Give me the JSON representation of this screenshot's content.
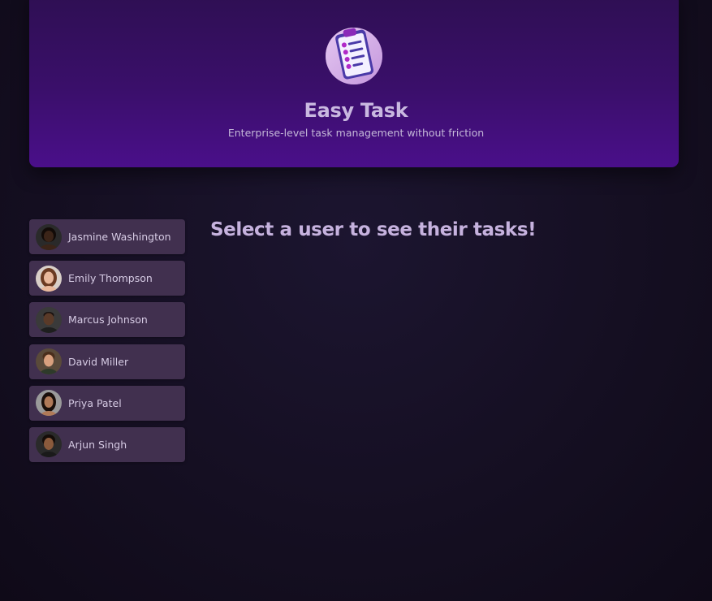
{
  "header": {
    "logo_icon": "clipboard-checklist-icon",
    "title": "Easy Task",
    "subtitle": "Enterprise-level task management without friction"
  },
  "users": [
    {
      "name": "Jasmine Washington",
      "skin": "#3b2418",
      "hair": "#120b08",
      "bg": "#2a2a2a"
    },
    {
      "name": "Emily Thompson",
      "skin": "#e9b89c",
      "hair": "#6b3a22",
      "bg": "#d9cfc8"
    },
    {
      "name": "Marcus Johnson",
      "skin": "#5a3a28",
      "hair": "#1a1210",
      "bg": "#3a3a3a"
    },
    {
      "name": "David Miller",
      "skin": "#d9a07e",
      "hair": "#4a2e1c",
      "bg": "#5a4a3a"
    },
    {
      "name": "Priya Patel",
      "skin": "#b07a58",
      "hair": "#1a0f0a",
      "bg": "#9a9a9a"
    },
    {
      "name": "Arjun Singh",
      "skin": "#8a5a3c",
      "hair": "#140c08",
      "bg": "#2a2a2a"
    }
  ],
  "main": {
    "prompt": "Select a user to see their tasks!"
  },
  "colors": {
    "header_top": "#2e0f52",
    "header_bottom": "#4a0f8a",
    "user_item_bg": "#41304f",
    "title_text": "#c9b8e0"
  }
}
